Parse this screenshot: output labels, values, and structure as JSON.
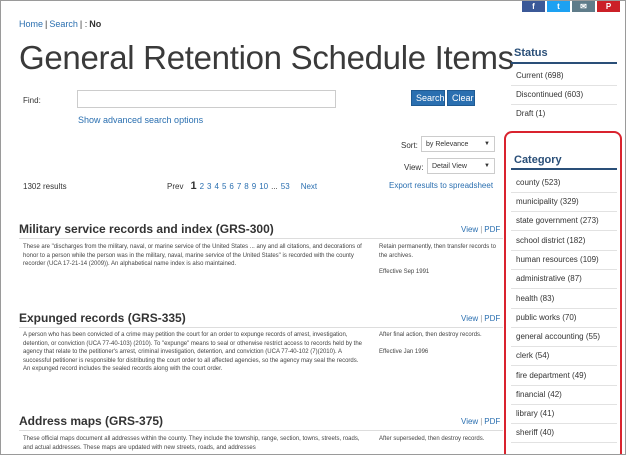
{
  "breadcrumb": {
    "home": "Home",
    "search": "Search",
    "current": "No"
  },
  "social": {
    "facebook": "f",
    "twitter": "t",
    "mail": "✉",
    "pinterest": "P"
  },
  "page_title": "General Retention Schedule Items",
  "find": {
    "label": "Find:",
    "value": "",
    "placeholder": ""
  },
  "buttons": {
    "search": "Search",
    "clear": "Clear"
  },
  "advanced_link": "Show advanced search options",
  "sort": {
    "label": "Sort:",
    "value": "by Relevance"
  },
  "view": {
    "label": "View:",
    "value": "Detail View"
  },
  "results_count": "1302 results",
  "pager": {
    "prev": "Prev",
    "current": "1",
    "pages": [
      "2",
      "3",
      "4",
      "5",
      "6",
      "7",
      "8",
      "9",
      "10"
    ],
    "ellipsis": "...",
    "last": "53",
    "next": "Next"
  },
  "export_link": "Export results to spreadsheet",
  "record_links": {
    "view": "View",
    "pdf": "PDF"
  },
  "records": [
    {
      "title": "Military service records and index (GRS-300)",
      "description": "These are \"discharges from the military, naval, or marine service of the United States ... any and all citations, and decorations of honor to a person while the person was in the military, naval, marine service of the United States\" is recorded with the county recorder (UCA 17-21-14 (2009)). An alphabetical name index is also maintained.",
      "action": "Retain permanently, then transfer records to the archives.",
      "effective": "Effective Sep 1991"
    },
    {
      "title": "Expunged records (GRS-335)",
      "description": "A person who has been convicted of a crime may petition the court for an order to expunge records of arrest, investigation, detention, or conviction (UCA 77-40-103) (2010). To \"expunge\" means to seal or otherwise restrict access to records held by the agency that relate to the petitioner's arrest, criminal investigation, detention, and conviction (UCA 77-40-102 (7)(2010). A successful petitioner is responsible for distributing the court order to all affected agencies, so the agency may seal the records. An expunged record includes the sealed records along with the court order.",
      "action": "After final action, then destroy records.",
      "effective": "Effective Jan 1996"
    },
    {
      "title": "Address maps (GRS-375)",
      "description": "These official maps document all addresses within the county. They include the township, range, section, towns, streets, roads, and actual addresses. These maps are updated with new streets, roads, and addresses",
      "action": "After superseded, then destroy records.",
      "effective": ""
    }
  ],
  "status": {
    "title": "Status",
    "items": [
      "Current (698)",
      "Discontinued (603)",
      "Draft (1)"
    ]
  },
  "category": {
    "title": "Category",
    "items": [
      "county (523)",
      "municipality (329)",
      "state government (273)",
      "school district (182)",
      "human resources (109)",
      "administrative (87)",
      "health (83)",
      "public works (70)",
      "general accounting (55)",
      "clerk (54)",
      "fire department (49)",
      "financial (42)",
      "library (41)",
      "sheriff (40)"
    ]
  },
  "colors": {
    "link": "#2a6fb0",
    "button": "#2a6fb0",
    "sidebar_title": "#2a4f78",
    "highlight": "#d9232e"
  }
}
